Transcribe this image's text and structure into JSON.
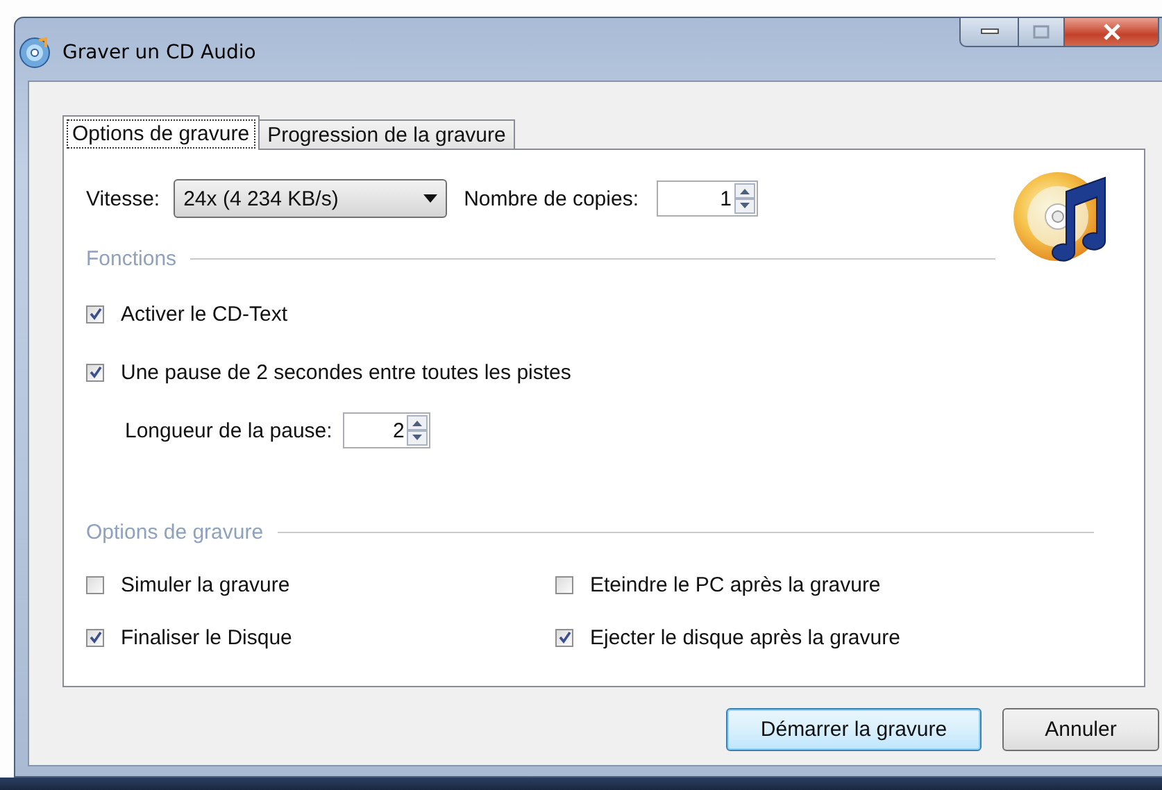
{
  "window": {
    "title": "Graver un CD Audio"
  },
  "tabs": [
    {
      "label": "Options de gravure",
      "selected": true
    },
    {
      "label": "Progression de la gravure",
      "selected": false
    }
  ],
  "speed": {
    "label": "Vitesse:",
    "value": "24x (4 234 KB/s)"
  },
  "copies": {
    "label": "Nombre de copies:",
    "value": "1"
  },
  "functions": {
    "title": "Fonctions",
    "items": [
      {
        "kind": "checkbox",
        "label": "Activer le CD-Text",
        "checked": true
      },
      {
        "kind": "checkbox",
        "label": "Une pause de 2 secondes entre toutes les pistes",
        "checked": true
      },
      {
        "kind": "spinner",
        "label": "Longueur de la pause:",
        "value": "2"
      }
    ]
  },
  "burn_options": {
    "title": "Options de gravure",
    "items": [
      {
        "label": "Simuler la gravure",
        "checked": false
      },
      {
        "label": "Eteindre le PC après la gravure",
        "checked": false
      },
      {
        "label": "Finaliser le Disque",
        "checked": true
      },
      {
        "label": "Ejecter le disque après la gravure",
        "checked": true
      }
    ]
  },
  "buttons": [
    {
      "label": "Démarrer la gravure",
      "default": true
    },
    {
      "label": "Annuler",
      "default": false
    }
  ]
}
